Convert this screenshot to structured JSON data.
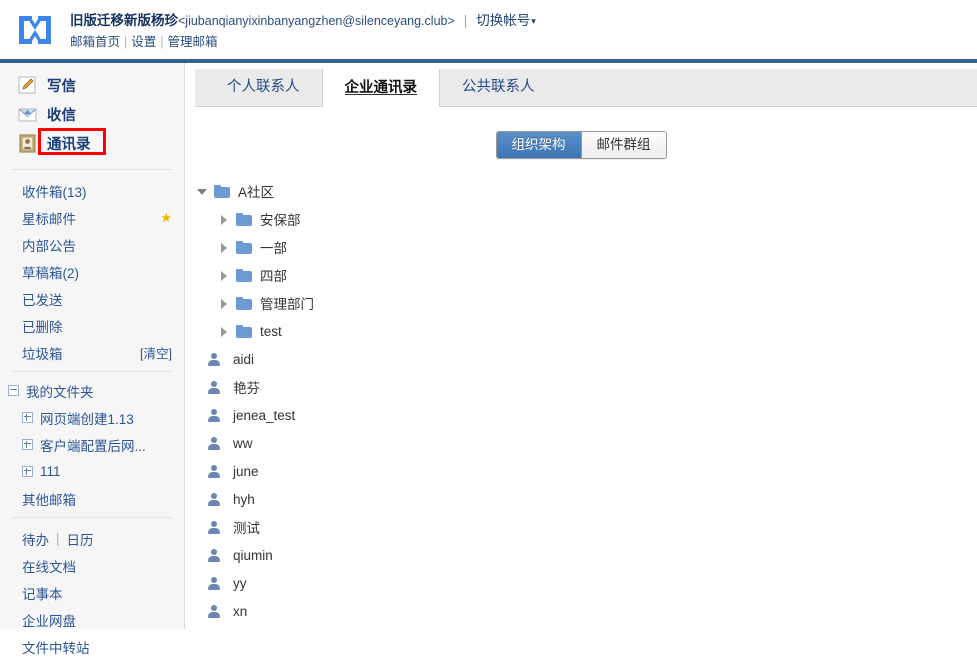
{
  "header": {
    "logo_name": "mailbox-logo",
    "account_name": "旧版迁移新版杨珍",
    "account_email": "<jiubanqianyixinbanyangzhen@silenceyang.club>",
    "divider": "|",
    "switch_account": "切换帐号",
    "caret": "▾",
    "links": [
      {
        "label": "邮箱首页"
      },
      {
        "label": "设置"
      },
      {
        "label": "管理邮箱"
      }
    ],
    "link_separator": "|"
  },
  "sidebar": {
    "nav": [
      {
        "label": "写信",
        "icon": "compose-icon"
      },
      {
        "label": "收信",
        "icon": "receive-icon"
      },
      {
        "label": "通讯录",
        "icon": "contacts-icon",
        "highlighted": true
      }
    ],
    "folders": [
      {
        "label": "收件箱(13)",
        "right": "",
        "star": false
      },
      {
        "label": "星标邮件",
        "right": "",
        "star": true
      },
      {
        "label": "内部公告",
        "right": "",
        "star": false
      },
      {
        "label": "草稿箱(2)",
        "right": "",
        "star": false
      },
      {
        "label": "已发送",
        "right": "",
        "star": false
      },
      {
        "label": "已删除",
        "right": "",
        "star": false
      },
      {
        "label": "垃圾箱",
        "right": "[清空]",
        "star": false
      }
    ],
    "my_folders": {
      "root_label": "我的文件夹",
      "root_expanded": true,
      "children": [
        {
          "label": "网页端创建1.13",
          "expanded": false
        },
        {
          "label": "客户端配置后网...",
          "expanded": false
        },
        {
          "label": "111",
          "expanded": false
        }
      ],
      "other": "其他邮箱"
    },
    "tools": [
      {
        "label": "待办",
        "sep": "|",
        "label2": "日历"
      },
      {
        "label": "在线文档"
      },
      {
        "label": "记事本"
      },
      {
        "label": "企业网盘"
      },
      {
        "label": "文件中转站"
      }
    ]
  },
  "content": {
    "tabs": [
      {
        "label": "个人联系人",
        "active": false
      },
      {
        "label": "企业通讯录",
        "active": true
      },
      {
        "label": "公共联系人",
        "active": false
      }
    ],
    "segmented": [
      {
        "label": "组织架构",
        "active": true
      },
      {
        "label": "邮件群组",
        "active": false
      }
    ],
    "org_tree": [
      {
        "label": "A社区",
        "level": 0,
        "expanded": true
      },
      {
        "label": "安保部",
        "level": 1,
        "expanded": false
      },
      {
        "label": "一部",
        "level": 1,
        "expanded": false
      },
      {
        "label": "四部",
        "level": 1,
        "expanded": false
      },
      {
        "label": "管理部门",
        "level": 1,
        "expanded": false
      },
      {
        "label": "test",
        "level": 1,
        "expanded": false
      }
    ],
    "people": [
      {
        "name": "aidi"
      },
      {
        "name": "艳芬"
      },
      {
        "name": "jenea_test"
      },
      {
        "name": "ww"
      },
      {
        "name": "june"
      },
      {
        "name": "hyh"
      },
      {
        "name": "测试"
      },
      {
        "name": "qiumin"
      },
      {
        "name": "yy"
      },
      {
        "name": "xn"
      }
    ]
  },
  "colors": {
    "accent_blue": "#3c74b4",
    "rule_blue": "#36618e",
    "link_blue": "#2d5596",
    "highlight_red": "#ff0000",
    "folder_blue": "#6c9bd2"
  }
}
